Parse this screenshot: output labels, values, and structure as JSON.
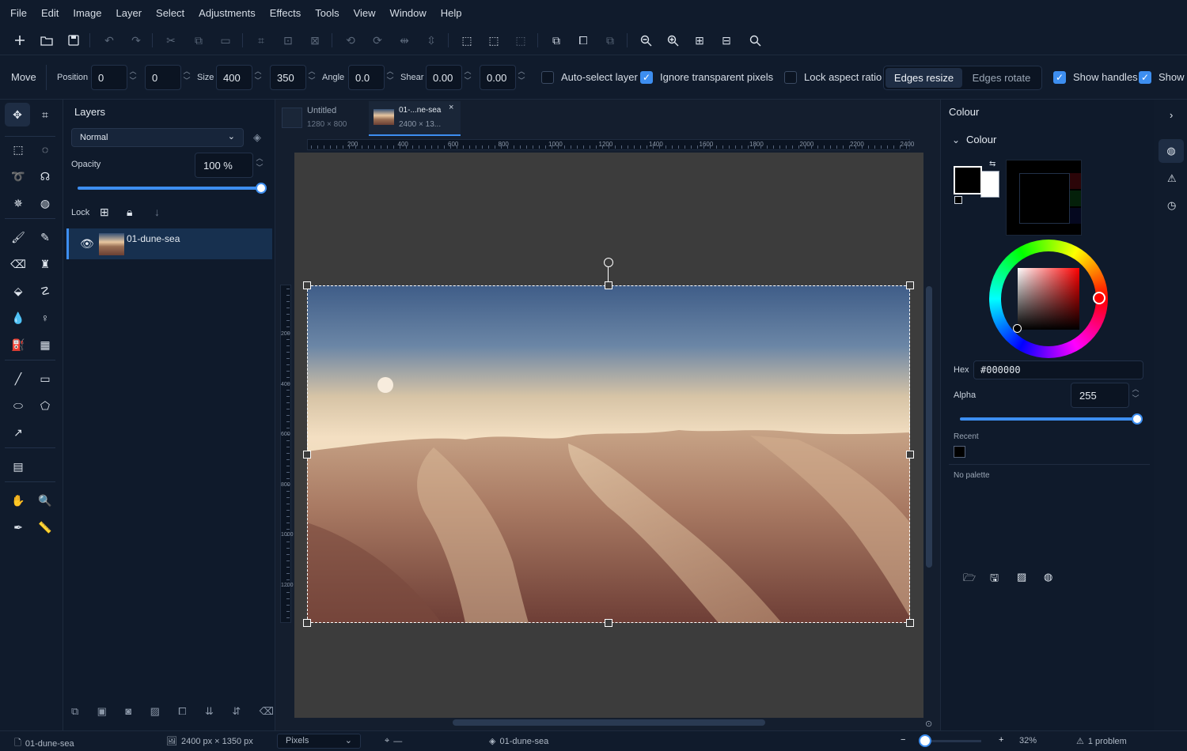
{
  "menu": [
    "File",
    "Edit",
    "Image",
    "Layer",
    "Select",
    "Adjustments",
    "Effects",
    "Tools",
    "View",
    "Window",
    "Help"
  ],
  "options": {
    "tool_name": "Move",
    "position_label": "Position",
    "pos_x": "0",
    "pos_y": "0",
    "size_label": "Size",
    "width": "400",
    "height": "350",
    "angle_label": "Angle",
    "angle": "0.0",
    "shear_label": "Shear",
    "shear_x": "0.00",
    "shear_y": "0.00",
    "auto_select": "Auto-select layer",
    "ignore_transparent": "Ignore transparent pixels",
    "lock_aspect": "Lock aspect ratio",
    "edges_resize": "Edges resize",
    "edges_rotate": "Edges rotate",
    "show_handles": "Show handles",
    "show_more": "Show"
  },
  "layers_panel": {
    "title": "Layers",
    "blend_mode": "Normal",
    "opacity_label": "Opacity",
    "opacity_value": "100 %",
    "opacity_fraction": 1.0,
    "lock_label": "Lock",
    "items": [
      {
        "name": "01-dune-sea",
        "visible": true
      }
    ]
  },
  "tabs": [
    {
      "title": "Untitled",
      "dims": "1280 × 800",
      "active": false
    },
    {
      "title": "01-...ne-sea",
      "dims": "2400 × 13...",
      "active": true
    }
  ],
  "ruler": {
    "h_ticks": [
      "200",
      "400",
      "600",
      "800",
      "1000",
      "1200",
      "1400",
      "1600",
      "1800",
      "2000",
      "2200",
      "2400"
    ],
    "v_ticks": [
      "200",
      "400",
      "600",
      "800",
      "1000",
      "1200"
    ]
  },
  "colour_panel": {
    "header": "Colour",
    "section": "Colour",
    "hex_label": "Hex",
    "hex_value": "#000000",
    "alpha_label": "Alpha",
    "alpha_value": "255",
    "alpha_fraction": 1.0,
    "recent_label": "Recent",
    "palette_label": "No palette",
    "primary_color": "#000000",
    "secondary_color": "#ffffff"
  },
  "status": {
    "document": "01-dune-sea",
    "dimensions": "2400 px × 1350 px",
    "units": "Pixels",
    "cursor": "—",
    "layer": "01-dune-sea",
    "zoom": "32%",
    "problems": "1 problem"
  },
  "colors": {
    "accent": "#3d8ef0",
    "canvas_bg": "#3c3c3c",
    "panel_bg": "#0f1a2b"
  }
}
